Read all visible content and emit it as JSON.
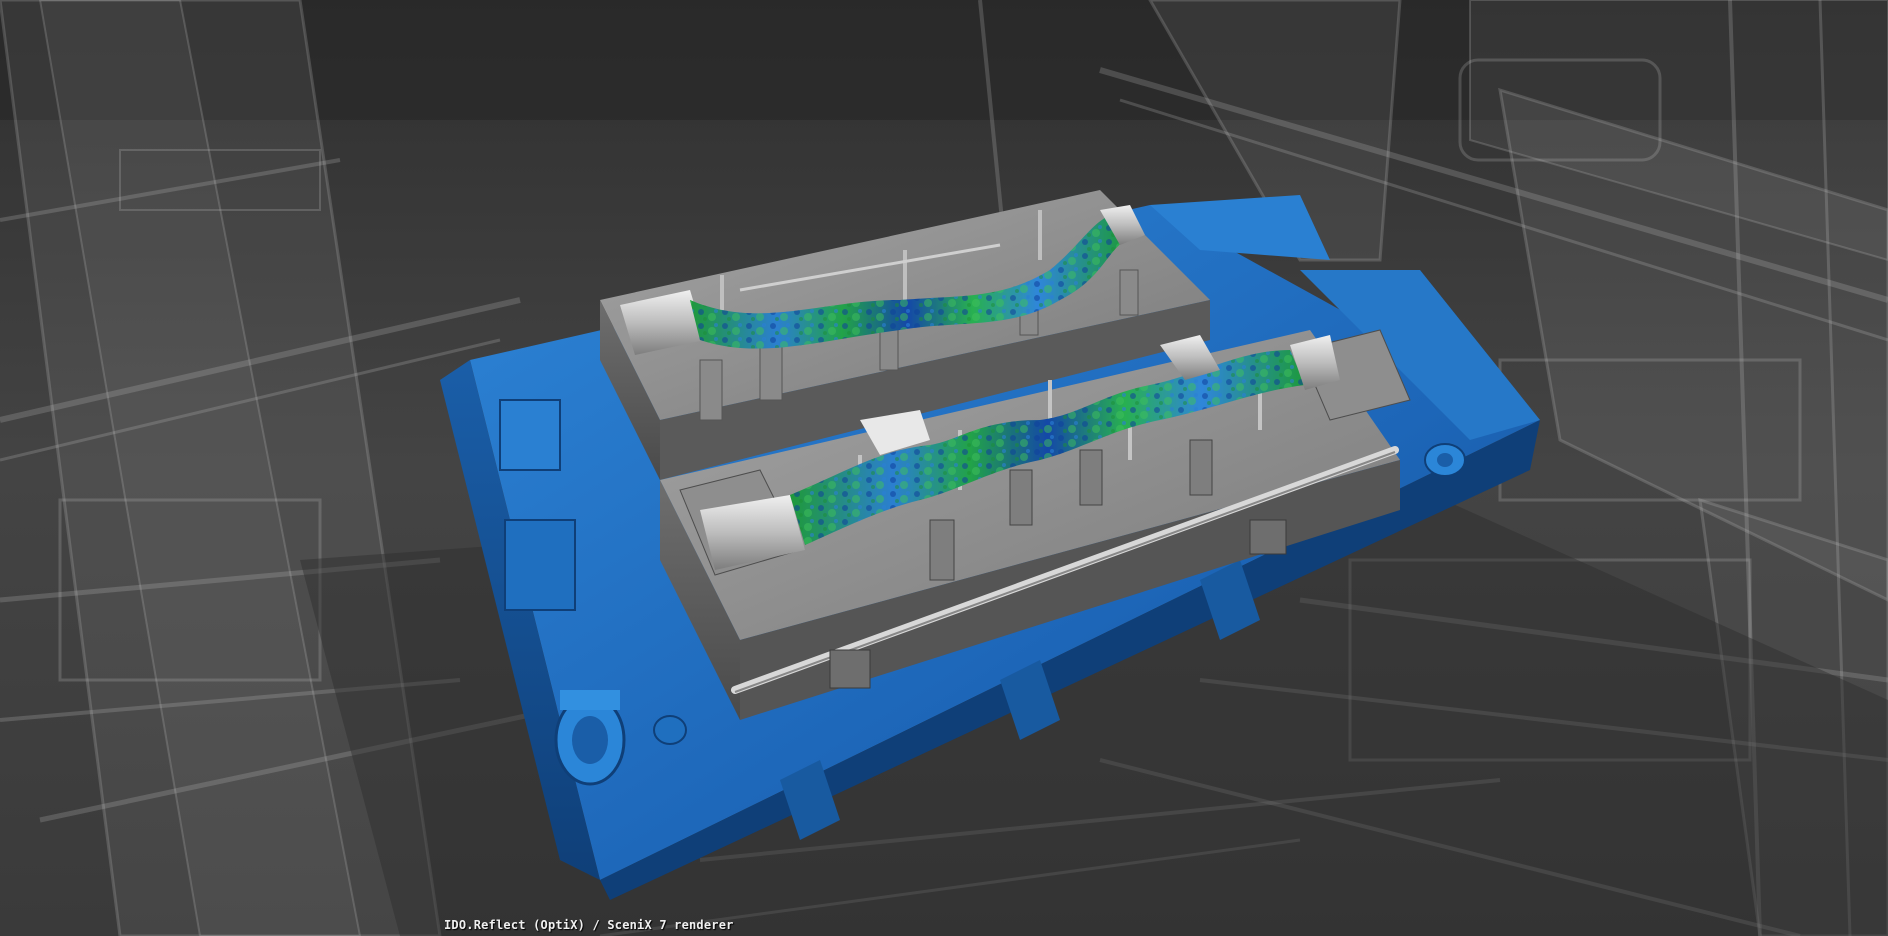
{
  "viewer": {
    "status_text": "IDO.Reflect (OptiX) / SceniX 7 renderer"
  },
  "scene": {
    "background_color": "#3c3c3c",
    "base_color": "#1f6fbf",
    "tool_color": "#8e8e8e",
    "scan_colors": [
      "#1a8a2a",
      "#2f7fd8",
      "#0f3f9f",
      "#33b84d"
    ],
    "ghost_color": "#b8b8b8",
    "content_description_icon": "cad-model-3d-view"
  }
}
